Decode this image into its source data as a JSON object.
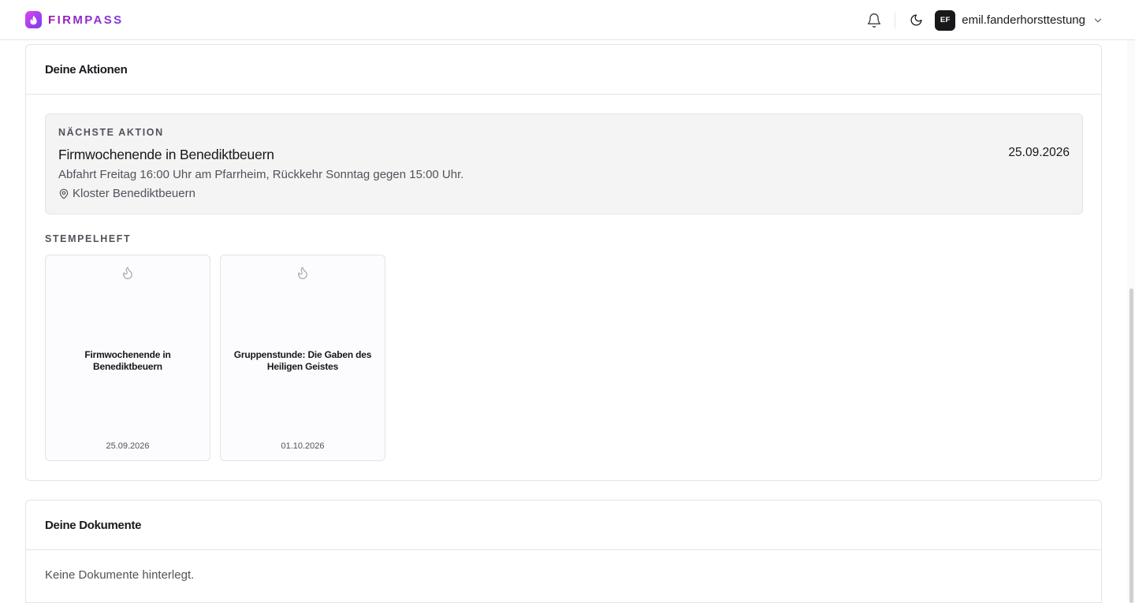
{
  "header": {
    "brand": "FIRMPASS",
    "avatar_initials": "EF",
    "username": "emil.fanderhorsttestung",
    "icons": [
      "bell-icon",
      "moon-icon",
      "chevron-down-icon"
    ]
  },
  "actions": {
    "title": "Deine Aktionen",
    "next": {
      "label": "NÄCHSTE AKTION",
      "title": "Firmwochenende in Benediktbeuern",
      "date": "25.09.2026",
      "description": "Abfahrt Freitag 16:00 Uhr am Pfarrheim, Rückkehr Sonntag gegen 15:00 Uhr.",
      "location": "Kloster Benediktbeuern"
    },
    "stamp_label": "STEMPELHEFT",
    "stamps": [
      {
        "title": "Firmwochenende in Benediktbeuern",
        "date": "25.09.2026",
        "icon": "flame-icon"
      },
      {
        "title": "Gruppenstunde: Die Gaben des Heiligen Geistes",
        "date": "01.10.2026",
        "icon": "flame-icon"
      }
    ]
  },
  "documents": {
    "title": "Deine Dokumente",
    "empty": "Keine Dokumente hinterlegt."
  },
  "colors": {
    "brand_start": "#d946ef",
    "brand_end": "#7c3aed",
    "border": "#e4e4e7",
    "muted_text": "#52525b"
  }
}
